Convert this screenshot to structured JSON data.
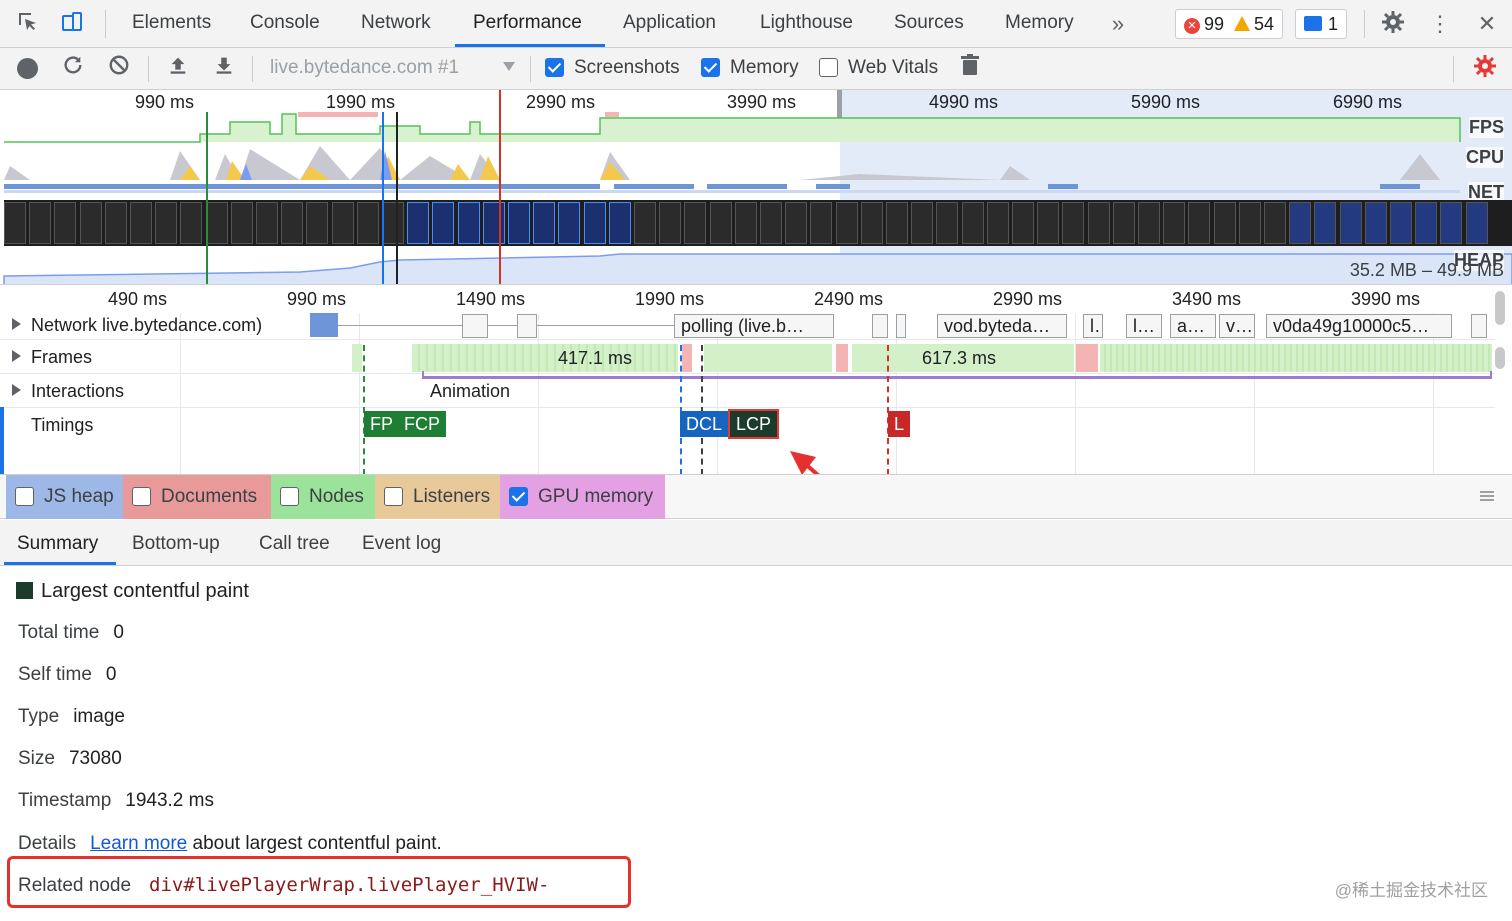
{
  "tabbar": {
    "tabs": [
      "Elements",
      "Console",
      "Network",
      "Performance",
      "Application",
      "Lighthouse",
      "Sources",
      "Memory"
    ],
    "active_tab": "Performance",
    "errors": "99",
    "warnings": "54",
    "messages": "1"
  },
  "toolbar": {
    "url_select": "live.bytedance.com #1",
    "screenshots_label": "Screenshots",
    "screenshots_checked": true,
    "memory_label": "Memory",
    "memory_checked": true,
    "webvitals_label": "Web Vitals",
    "webvitals_checked": false
  },
  "overview": {
    "ticks": [
      "990 ms",
      "1990 ms",
      "2990 ms",
      "3990 ms",
      "4990 ms",
      "5990 ms",
      "6990 ms"
    ],
    "labels": {
      "fps": "FPS",
      "cpu": "CPU",
      "net": "NET",
      "heap": "HEAP"
    },
    "heap_range": "35.2 MB – 49.9 MB"
  },
  "timeline": {
    "ticks": [
      "490 ms",
      "990 ms",
      "1490 ms",
      "1990 ms",
      "2490 ms",
      "2990 ms",
      "3490 ms",
      "3990 ms"
    ],
    "tracks": {
      "network": "Network live.bytedance.com)",
      "frames": "Frames",
      "interactions": "Interactions",
      "timings": "Timings"
    },
    "network_requests": [
      "polling (live.b…",
      "vod.byteda…",
      "l…",
      "a…",
      "v…",
      "v0da49g10000c5…"
    ],
    "frame_durations": [
      "417.1 ms",
      "617.3 ms"
    ],
    "interaction": "Animation",
    "timing_markers": [
      {
        "label": "FP",
        "color": "#1e7e34"
      },
      {
        "label": "FCP",
        "color": "#1e7e34"
      },
      {
        "label": "DCL",
        "color": "#1565c0"
      },
      {
        "label": "LCP",
        "color": "#1d3b2b"
      },
      {
        "label": "L",
        "color": "#c62828"
      }
    ]
  },
  "counters": [
    {
      "label": "JS heap",
      "checked": false,
      "color": "#9db8e6"
    },
    {
      "label": "Documents",
      "checked": false,
      "color": "#e89a9a"
    },
    {
      "label": "Nodes",
      "checked": false,
      "color": "#9be39b"
    },
    {
      "label": "Listeners",
      "checked": false,
      "color": "#e8c99a"
    },
    {
      "label": "GPU memory",
      "checked": true,
      "color": "#e3a0e3"
    }
  ],
  "bottom_tabs": [
    "Summary",
    "Bottom-up",
    "Call tree",
    "Event log"
  ],
  "active_bottom_tab": "Summary",
  "summary": {
    "title": "Largest contentful paint",
    "total_time_label": "Total time",
    "total_time": "0",
    "self_time_label": "Self time",
    "self_time": "0",
    "type_label": "Type",
    "type": "image",
    "size_label": "Size",
    "size": "73080",
    "timestamp_label": "Timestamp",
    "timestamp": "1943.2 ms",
    "details_label": "Details",
    "details_link": "Learn more",
    "details_text": "about largest contentful paint.",
    "related_node_label": "Related node",
    "related_node": "div#livePlayerWrap.livePlayer_HVIW-"
  },
  "watermark": "@稀土掘金技术社区"
}
